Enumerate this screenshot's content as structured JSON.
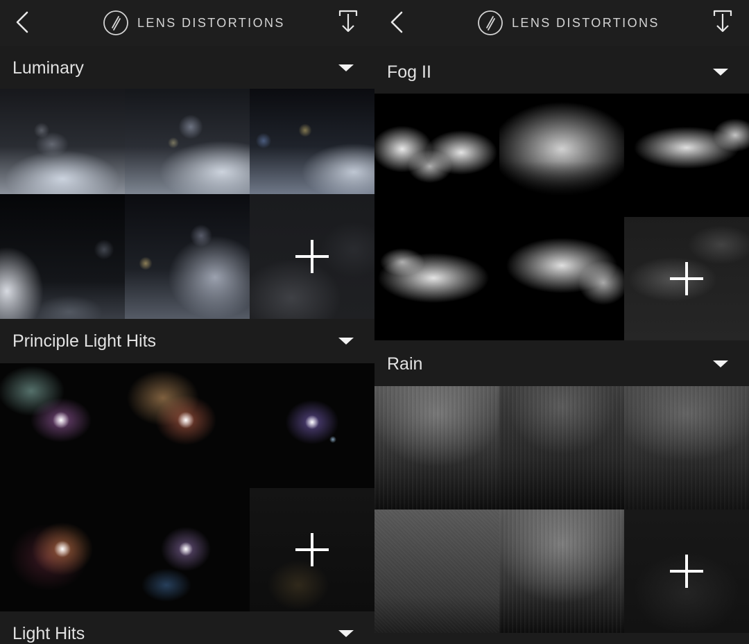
{
  "app": {
    "title": "LENS DISTORTIONS"
  },
  "icons": {
    "back": "chevron-left-icon",
    "logo": "lens-distortions-logo-icon",
    "download": "download-icon",
    "collapse": "caret-down-icon",
    "add": "plus-icon"
  },
  "colors": {
    "background": "#1c1c1c",
    "tile_background": "#000000",
    "text": "#e2e2e2",
    "accent": "#ffffff"
  },
  "left_panel": {
    "sections": [
      {
        "title": "Luminary",
        "tiles": 5,
        "has_add_tile": true
      },
      {
        "title": "Principle Light Hits",
        "tiles": 5,
        "has_add_tile": true
      },
      {
        "title": "Light Hits"
      }
    ]
  },
  "right_panel": {
    "sections": [
      {
        "title": "Fog II",
        "tiles": 5,
        "has_add_tile": true
      },
      {
        "title": "Rain",
        "tiles": 5,
        "has_add_tile": true
      }
    ]
  }
}
